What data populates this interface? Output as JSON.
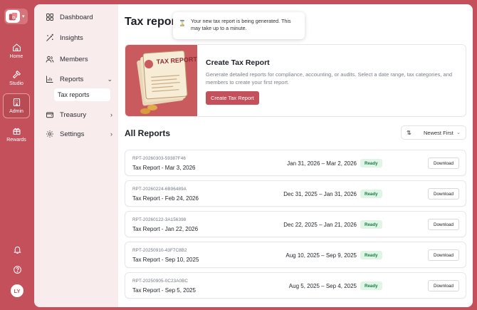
{
  "rail": {
    "items": [
      {
        "label": "Home",
        "icon": "home-icon"
      },
      {
        "label": "Studio",
        "icon": "hammer-icon"
      },
      {
        "label": "Admin",
        "icon": "building-icon"
      },
      {
        "label": "Rewards",
        "icon": "gift-icon"
      }
    ],
    "avatar_initials": "LY"
  },
  "sidebar": {
    "items": [
      {
        "label": "Dashboard",
        "icon": "grid-icon"
      },
      {
        "label": "Insights",
        "icon": "wand-icon"
      },
      {
        "label": "Members",
        "icon": "users-icon"
      },
      {
        "label": "Reports",
        "icon": "bar-chart-icon"
      },
      {
        "label": "Treasury",
        "icon": "wallet-icon"
      },
      {
        "label": "Settings",
        "icon": "gear-icon"
      }
    ],
    "sub_item": "Tax reports"
  },
  "main": {
    "title": "Tax reports",
    "toast": "Your new tax report is being generated. This may take up to a minute.",
    "banner": {
      "art_label": "TAX REPORT",
      "title": "Create Tax Report",
      "description": "Generate detailed reports for compliance, accounting, or audits. Select a date range, tax categories, and members to create your first report.",
      "button": "Create Tax Report"
    },
    "section_title": "All Reports",
    "sort_label": "Newest First",
    "reports": [
      {
        "id": "RPT-20260303-59387F46",
        "name": "Tax Report - Mar 3, 2026",
        "range": "Jan 31, 2026 – Mar 2, 2026",
        "status": "Ready",
        "action": "Download"
      },
      {
        "id": "RPT-20260224-6B96489A",
        "name": "Tax Report - Feb 24, 2026",
        "range": "Dec 31, 2025 – Jan 31, 2026",
        "status": "Ready",
        "action": "Download"
      },
      {
        "id": "RPT-20260122-3A156398",
        "name": "Tax Report - Jan 22, 2026",
        "range": "Dec 22, 2025 – Jan 21, 2026",
        "status": "Ready",
        "action": "Download"
      },
      {
        "id": "RPT-20250910-43F7C8B2",
        "name": "Tax Report - Sep 10, 2025",
        "range": "Aug 10, 2025 – Sep 9, 2025",
        "status": "Ready",
        "action": "Download"
      },
      {
        "id": "RPT-20250905-0C23A0BC",
        "name": "Tax Report - Sep 5, 2025",
        "range": "Aug 5, 2025 – Sep 4, 2025",
        "status": "Ready",
        "action": "Download"
      }
    ]
  },
  "colors": {
    "brand": "#c3505a",
    "sidebar_bg": "#f9ecec",
    "ready_bg": "#dff5e6",
    "ready_text": "#1d7a45"
  }
}
